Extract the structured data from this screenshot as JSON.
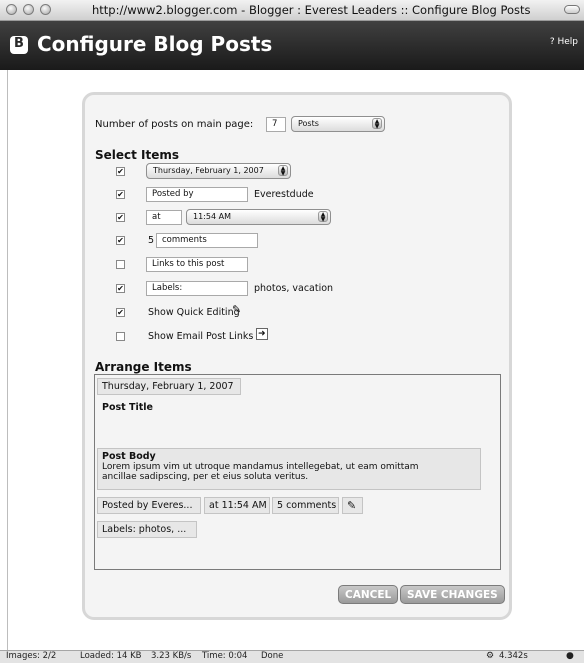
{
  "window": {
    "title": "http://www2.blogger.com - Blogger : Everest Leaders :: Configure Blog Posts"
  },
  "header": {
    "title": "Configure Blog Posts",
    "help": "? Help"
  },
  "posts": {
    "label": "Number of posts on main page:",
    "count": "7",
    "unit": "Posts"
  },
  "select_items": {
    "heading": "Select Items",
    "date_format": "Thursday, February 1, 2007",
    "posted_by_label": "Posted by",
    "posted_by_value": "Everestdude",
    "at_label": "at",
    "time_format": "11:54 AM",
    "comments_prefix": "5",
    "comments_label": "comments",
    "links_label": "Links to this post",
    "labels_label": "Labels:",
    "labels_value": "photos, vacation",
    "quick_edit": "Show Quick Editing",
    "email_links": "Show Email Post Links"
  },
  "checkboxes": {
    "date": true,
    "posted_by": true,
    "time": true,
    "comments": true,
    "links": false,
    "labels": true,
    "quick_edit": true,
    "email": false
  },
  "arrange": {
    "heading": "Arrange Items",
    "date": "Thursday, February 1, 2007",
    "title": "Post Title",
    "body_title": "Post Body",
    "body_text_1": "Lorem ipsum vim ut utroque mandamus intellegebat, ut eam omittam",
    "body_text_2": "ancillae sadipscing, per et eius soluta veritus.",
    "footer_posted": "Posted by Everes...",
    "footer_time": "at 11:54 AM",
    "footer_comments": "5 comments",
    "footer_labels": "Labels: photos, ..."
  },
  "buttons": {
    "cancel": "CANCEL",
    "save": "SAVE CHANGES"
  },
  "status": {
    "images": "Images: 2/2",
    "loaded": "Loaded: 14 KB",
    "speed": "3.23 KB/s",
    "time": "Time: 0:04",
    "state": "Done",
    "timer": "4.342s"
  }
}
